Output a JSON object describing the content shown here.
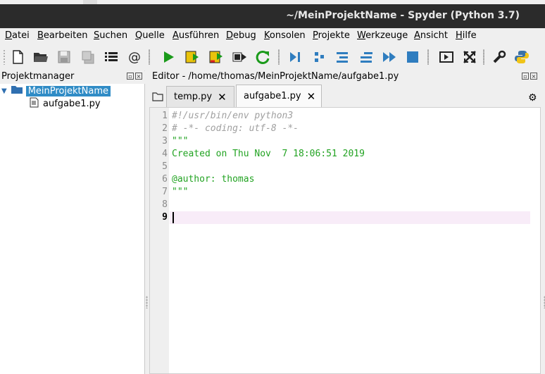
{
  "window": {
    "title": "~/MeinProjektName - Spyder (Python 3.7)"
  },
  "menu": [
    {
      "label": "Datei",
      "u": "D",
      "rest": "atei"
    },
    {
      "label": "Bearbeiten",
      "u": "B",
      "rest": "earbeiten"
    },
    {
      "label": "Suchen",
      "u": "S",
      "rest": "uchen"
    },
    {
      "label": "Quelle",
      "u": "Q",
      "rest": "uelle"
    },
    {
      "label": "Ausführen",
      "u": "A",
      "rest": "usführen"
    },
    {
      "label": "Debug",
      "u": "D",
      "rest": "ebug"
    },
    {
      "label": "Konsolen",
      "u": "K",
      "rest": "onsolen"
    },
    {
      "label": "Projekte",
      "u": "P",
      "rest": "rojekte"
    },
    {
      "label": "Werkzeuge",
      "u": "W",
      "rest": "erkzeuge"
    },
    {
      "label": "Ansicht",
      "u": "A",
      "rest": "nsicht"
    },
    {
      "label": "Hilfe",
      "u": "H",
      "rest": "ilfe"
    }
  ],
  "toolbar": {
    "icons": [
      "new-file-icon",
      "open-folder-icon",
      "save-icon",
      "save-all-icon",
      "list-icon",
      "at-icon",
      "run-icon",
      "run-cell-icon",
      "run-cell-advance-icon",
      "run-selection-icon",
      "rerun-icon",
      "debug-icon",
      "step-icon",
      "step-into-icon",
      "step-return-icon",
      "continue-icon",
      "stop-icon",
      "maximize-pane-icon",
      "fullscreen-icon",
      "wrench-icon",
      "python-icon"
    ],
    "colors": {
      "green": "#1a9a1a",
      "blue": "#2f7dbf",
      "yellow": "#e9c30b",
      "red": "#d22"
    }
  },
  "project_manager": {
    "header": "Projektmanager",
    "root": "MeinProjektName",
    "children": [
      "aufgabe1.py"
    ]
  },
  "editor": {
    "header": "Editor - /home/thomas/MeinProjektName/aufgabe1.py",
    "tabs": [
      {
        "label": "temp.py",
        "active": false
      },
      {
        "label": "aufgabe1.py",
        "active": true
      }
    ],
    "lines": [
      {
        "n": "1",
        "text": "#!/usr/bin/env python3",
        "kind": "comment"
      },
      {
        "n": "2",
        "text": "# -*- coding: utf-8 -*-",
        "kind": "comment"
      },
      {
        "n": "3",
        "text": "\"\"\"",
        "kind": "string"
      },
      {
        "n": "4",
        "text": "Created on Thu Nov  7 18:06:51 2019",
        "kind": "string"
      },
      {
        "n": "5",
        "text": "",
        "kind": "string"
      },
      {
        "n": "6",
        "text": "@author: thomas",
        "kind": "string"
      },
      {
        "n": "7",
        "text": "\"\"\"",
        "kind": "string"
      },
      {
        "n": "8",
        "text": "",
        "kind": "plain"
      },
      {
        "n": "9",
        "text": "",
        "kind": "plain"
      }
    ],
    "current_line": "9"
  }
}
